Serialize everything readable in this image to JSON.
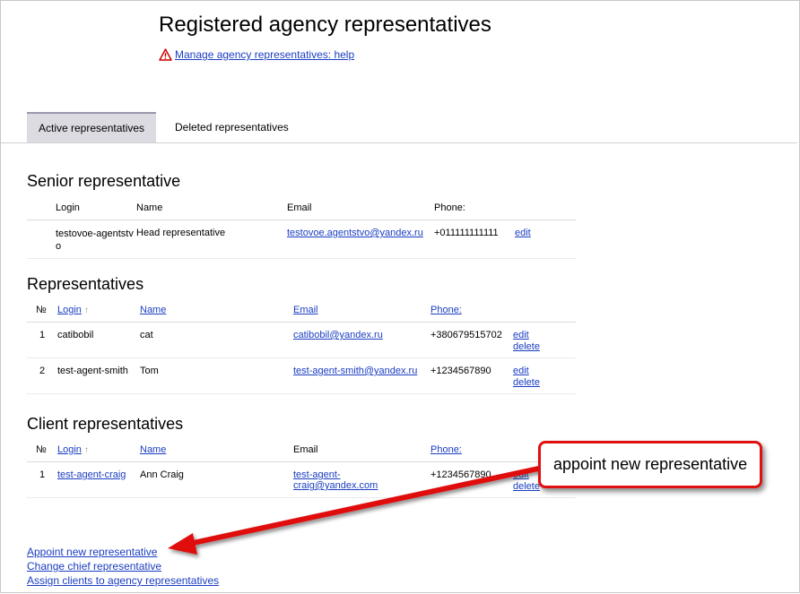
{
  "page": {
    "title": "Registered agency representatives",
    "help_link": "Manage agency representatives: help"
  },
  "tabs": [
    {
      "label": "Active representatives",
      "active": true
    },
    {
      "label": "Deleted representatives",
      "active": false
    }
  ],
  "senior": {
    "heading": "Senior representative",
    "columns": {
      "login": "Login",
      "name": "Name",
      "email": "Email",
      "phone": "Phone:"
    },
    "row": {
      "login": "testovoe-agentstvo",
      "name": "Head representative",
      "email": "testovoe.agentstvo@yandex.ru",
      "phone": "+011111111111",
      "edit": "edit"
    }
  },
  "representatives": {
    "heading": "Representatives",
    "columns": {
      "num": "№",
      "login": "Login",
      "login_sort": "↑",
      "name": "Name",
      "email": "Email",
      "phone": "Phone:"
    },
    "rows": [
      {
        "num": "1",
        "login": "catibobil",
        "name": "cat",
        "email": "catibobil@yandex.ru",
        "phone": "+380679515702",
        "edit": "edit",
        "delete": "delete"
      },
      {
        "num": "2",
        "login": "test-agent-smith",
        "name": "Tom",
        "email": "test-agent-smith@yandex.ru",
        "phone": "+1234567890",
        "edit": "edit",
        "delete": "delete"
      }
    ]
  },
  "clients": {
    "heading": "Client representatives",
    "columns": {
      "num": "№",
      "login": "Login",
      "login_sort": "↑",
      "name": "Name",
      "email": "Email",
      "phone": "Phone:"
    },
    "rows": [
      {
        "num": "1",
        "login": "test-agent-craig",
        "name": "Ann Craig",
        "email": "test-agent-craig@yandex.com",
        "phone": "+1234567890",
        "edit": "edit",
        "delete": "delete"
      }
    ]
  },
  "bottom_links": {
    "appoint": "Appoint new representative",
    "change_chief": "Change chief representative",
    "assign_clients": "Assign clients to agency representatives"
  },
  "annotation": {
    "callout_text": "appoint new representative",
    "color": "#e01010"
  },
  "colors": {
    "link": "#1a3dc1",
    "tab_active_bg": "#dddbe2",
    "warning": "#cc0000"
  }
}
